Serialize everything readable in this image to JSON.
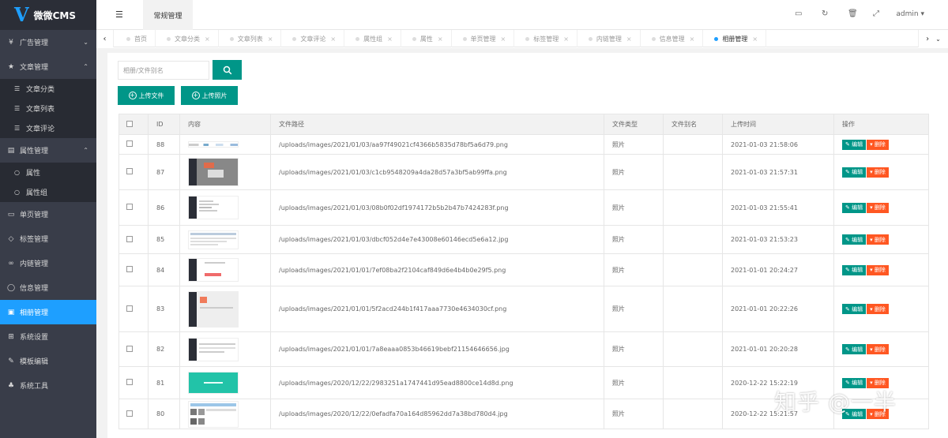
{
  "app": {
    "logo_letter": "V",
    "name": "微微CMS"
  },
  "sidebar": {
    "items": [
      {
        "label": "广告管理",
        "icon": "yen-icon"
      },
      {
        "label": "文章管理",
        "icon": "star-icon"
      },
      {
        "label": "属性管理",
        "icon": "layers-icon"
      },
      {
        "label": "单页管理",
        "icon": "page-icon"
      },
      {
        "label": "标签管理",
        "icon": "tag-icon"
      },
      {
        "label": "内链管理",
        "icon": "link-icon"
      },
      {
        "label": "信息管理",
        "icon": "message-icon"
      },
      {
        "label": "相册管理",
        "icon": "image-icon"
      },
      {
        "label": "系统设置",
        "icon": "windows-icon"
      },
      {
        "label": "模板编辑",
        "icon": "edit-icon"
      },
      {
        "label": "系统工具",
        "icon": "sitemap-icon"
      }
    ],
    "article_sub": [
      "文章分类",
      "文章列表",
      "文章评论"
    ],
    "attr_sub": [
      "属性",
      "属性组"
    ],
    "active": "相册管理"
  },
  "header": {
    "top_tab": "常规管理",
    "user": "admin"
  },
  "tabs": [
    "首页",
    "文章分类",
    "文章列表",
    "文章评论",
    "属性组",
    "属性",
    "单页管理",
    "标签管理",
    "内链管理",
    "信息管理",
    "相册管理"
  ],
  "toolbar": {
    "search_placeholder": "相册/文件别名",
    "upload_file": "上传文件",
    "upload_photo": "上传照片"
  },
  "table": {
    "headers": [
      "ID",
      "内容",
      "文件路径",
      "文件类型",
      "文件别名",
      "上传时间",
      "操作"
    ],
    "edit_label": "编辑",
    "delete_label": "删除",
    "rows": [
      {
        "id": "88",
        "path": "/uploads/images/2021/01/03/aa97f49021cf4366b5835d78bf5a6d79.png",
        "type": "照片",
        "alias": "",
        "time": "2021-01-03 21:58:06"
      },
      {
        "id": "87",
        "path": "/uploads/images/2021/01/03/c1cb9548209a4da28d57a3bf5ab99ffa.png",
        "type": "照片",
        "alias": "",
        "time": "2021-01-03 21:57:31"
      },
      {
        "id": "86",
        "path": "/uploads/images/2021/01/03/08b0f02df1974172b5b2b47b7424283f.png",
        "type": "照片",
        "alias": "",
        "time": "2021-01-03 21:55:41"
      },
      {
        "id": "85",
        "path": "/uploads/images/2021/01/03/dbcf052d4e7e43008e60146ecd5e6a12.jpg",
        "type": "照片",
        "alias": "",
        "time": "2021-01-03 21:53:23"
      },
      {
        "id": "84",
        "path": "/uploads/images/2021/01/01/7ef08ba2f2104caf849d6e4b4b0e29f5.png",
        "type": "照片",
        "alias": "",
        "time": "2021-01-01 20:24:27"
      },
      {
        "id": "83",
        "path": "/uploads/images/2021/01/01/5f2acd244b1f417aaa7730e4634030cf.png",
        "type": "照片",
        "alias": "",
        "time": "2021-01-01 20:22:26"
      },
      {
        "id": "82",
        "path": "/uploads/images/2021/01/01/7a8eaaa0853b46619bebf21154646656.jpg",
        "type": "照片",
        "alias": "",
        "time": "2021-01-01 20:20:28"
      },
      {
        "id": "81",
        "path": "/uploads/images/2020/12/22/2983251a1747441d95ead8800ce14d8d.png",
        "type": "照片",
        "alias": "",
        "time": "2020-12-22 15:22:19"
      },
      {
        "id": "80",
        "path": "/uploads/images/2020/12/22/0efadfa70a164d85962dd7a38bd780d4.jpg",
        "type": "照片",
        "alias": "",
        "time": "2020-12-22 15:21:57"
      }
    ]
  },
  "watermark": "知乎 @一半",
  "colors": {
    "sidebar": "#393d49",
    "active": "#1e9fff",
    "primary": "#009688",
    "danger": "#ff5722"
  }
}
